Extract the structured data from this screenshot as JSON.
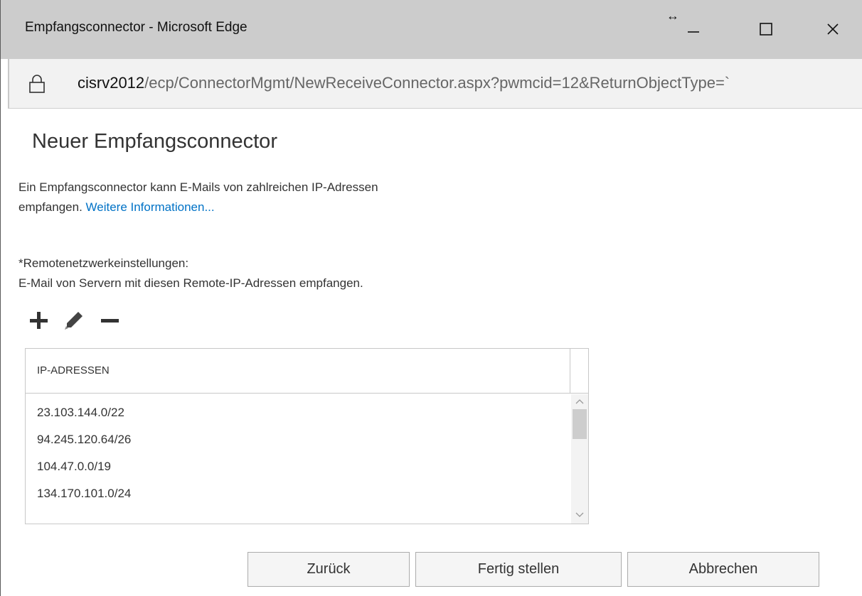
{
  "window": {
    "title": "Empfangsconnector - Microsoft Edge",
    "resize_glyph": "↔",
    "minimize_glyph": "—",
    "maximize_glyph": "☐",
    "close_glyph": "✕"
  },
  "address": {
    "host": "cisrv2012",
    "path": "/ecp/ConnectorMgmt/NewReceiveConnector.aspx?pwmcid=12&ReturnObjectType=`",
    "icon": "lock-icon"
  },
  "page": {
    "title": "Neuer Empfangsconnector",
    "description_line1": "Ein Empfangsconnector kann E-Mails von zahlreichen IP-Adressen",
    "description_line2": "empfangen. ",
    "more_info_link": "Weitere Informationen...",
    "remote_label": "*Remotenetzwerkeinstellungen:",
    "remote_hint": "E-Mail von Servern mit diesen Remote-IP-Adressen empfangen."
  },
  "toolbar": {
    "add_icon": "plus-icon",
    "edit_icon": "pencil-icon",
    "remove_icon": "minus-icon"
  },
  "table": {
    "header": "IP-ADRESSEN",
    "rows": [
      "23.103.144.0/22",
      "94.245.120.64/26",
      "104.47.0.0/19",
      "134.170.101.0/24"
    ]
  },
  "buttons": {
    "back": "Zurück",
    "finish": "Fertig stellen",
    "cancel": "Abbrechen"
  },
  "colors": {
    "titlebar": "#cccccc",
    "link": "#0072c6",
    "text": "#333333"
  }
}
